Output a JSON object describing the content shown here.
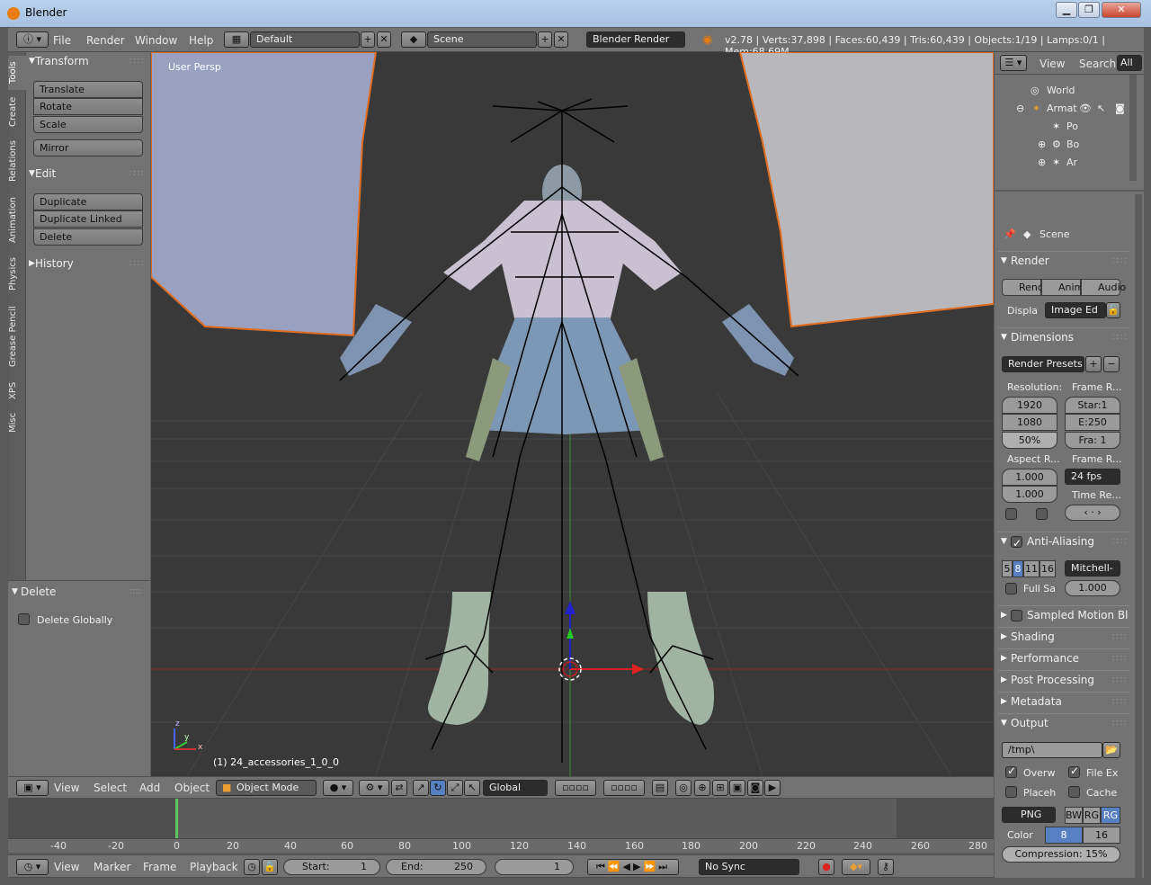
{
  "window": {
    "title": "Blender"
  },
  "menubar": {
    "items": [
      "File",
      "Render",
      "Window",
      "Help"
    ],
    "layout": "Default",
    "scene": "Scene",
    "engine": "Blender Render",
    "stats": "v2.78 | Verts:37,898 | Faces:60,439 | Tris:60,439 | Objects:1/19 | Lamps:0/1 | Mem:68.69M"
  },
  "toolshelf": {
    "tabs": [
      "Tools",
      "Create",
      "Relations",
      "Animation",
      "Physics",
      "Grease Pencil",
      "XPS",
      "Misc"
    ],
    "transform": {
      "title": "Transform",
      "buttons": [
        "Translate",
        "Rotate",
        "Scale"
      ],
      "mirror": "Mirror"
    },
    "edit": {
      "title": "Edit",
      "buttons": [
        "Duplicate",
        "Duplicate Linked",
        "Delete"
      ]
    },
    "history": {
      "title": "History"
    },
    "operator": {
      "title": "Delete",
      "option": "Delete Globally"
    }
  },
  "viewport": {
    "label": "User Persp",
    "object": "(1) 24_accessories_1_0_0",
    "axis_z": "z",
    "axis_y": "y",
    "axis_x": "x",
    "header": {
      "menus": [
        "View",
        "Select",
        "Add",
        "Object"
      ],
      "mode": "Object Mode",
      "orientation": "Global"
    }
  },
  "outliner": {
    "menus": [
      "View",
      "Search"
    ],
    "filter": "All",
    "items": [
      "World",
      "Armat",
      "Po",
      "Bo",
      "Ar"
    ]
  },
  "properties": {
    "scene": "Scene",
    "render": {
      "title": "Render",
      "buttons": [
        "Rend",
        "Anim",
        "Audio"
      ],
      "display_label": "Displa",
      "display_value": "Image Ed"
    },
    "dimensions": {
      "title": "Dimensions",
      "presets": "Render Presets",
      "resolution_label": "Resolution:",
      "res_x": "1920",
      "res_y": "1080",
      "res_pct": "50%",
      "frame_range_label": "Frame R...",
      "start": "Star:1",
      "end": "E:250",
      "step": "Fra: 1",
      "aspect_label": "Aspect R...",
      "aspect_x": "1.000",
      "aspect_y": "1.000",
      "frame_rate_label": "Frame R...",
      "fps": "24 fps",
      "time_remap_label": "Time Re..."
    },
    "antialiasing": {
      "title": "Anti-Aliasing",
      "samples": [
        "5",
        "8",
        "11",
        "16"
      ],
      "filter": "Mitchell-",
      "full_sample": "Full Sa",
      "size": "1.000"
    },
    "collapsed": [
      "Sampled Motion Bl",
      "Shading",
      "Performance",
      "Post Processing",
      "Metadata"
    ],
    "output": {
      "title": "Output",
      "path": "/tmp\\",
      "overwrite": "Overw",
      "file_ext": "File Ex",
      "placeholders": "Placeh",
      "cache": "Cache",
      "format": "PNG",
      "channels": [
        "BW",
        "RG",
        "RG"
      ],
      "color_label": "Color",
      "depth": [
        "8",
        "16"
      ],
      "compression": "Compression:",
      "compression_value": "15%"
    }
  },
  "timeline": {
    "ticks": [
      "-40",
      "-20",
      "0",
      "20",
      "40",
      "60",
      "80",
      "100",
      "120",
      "140",
      "160",
      "180",
      "200",
      "220",
      "240",
      "260",
      "280"
    ],
    "menus": [
      "View",
      "Marker",
      "Frame",
      "Playback"
    ],
    "start_label": "Start:",
    "start": "1",
    "end_label": "End:",
    "end": "250",
    "current": "1",
    "sync": "No Sync"
  }
}
